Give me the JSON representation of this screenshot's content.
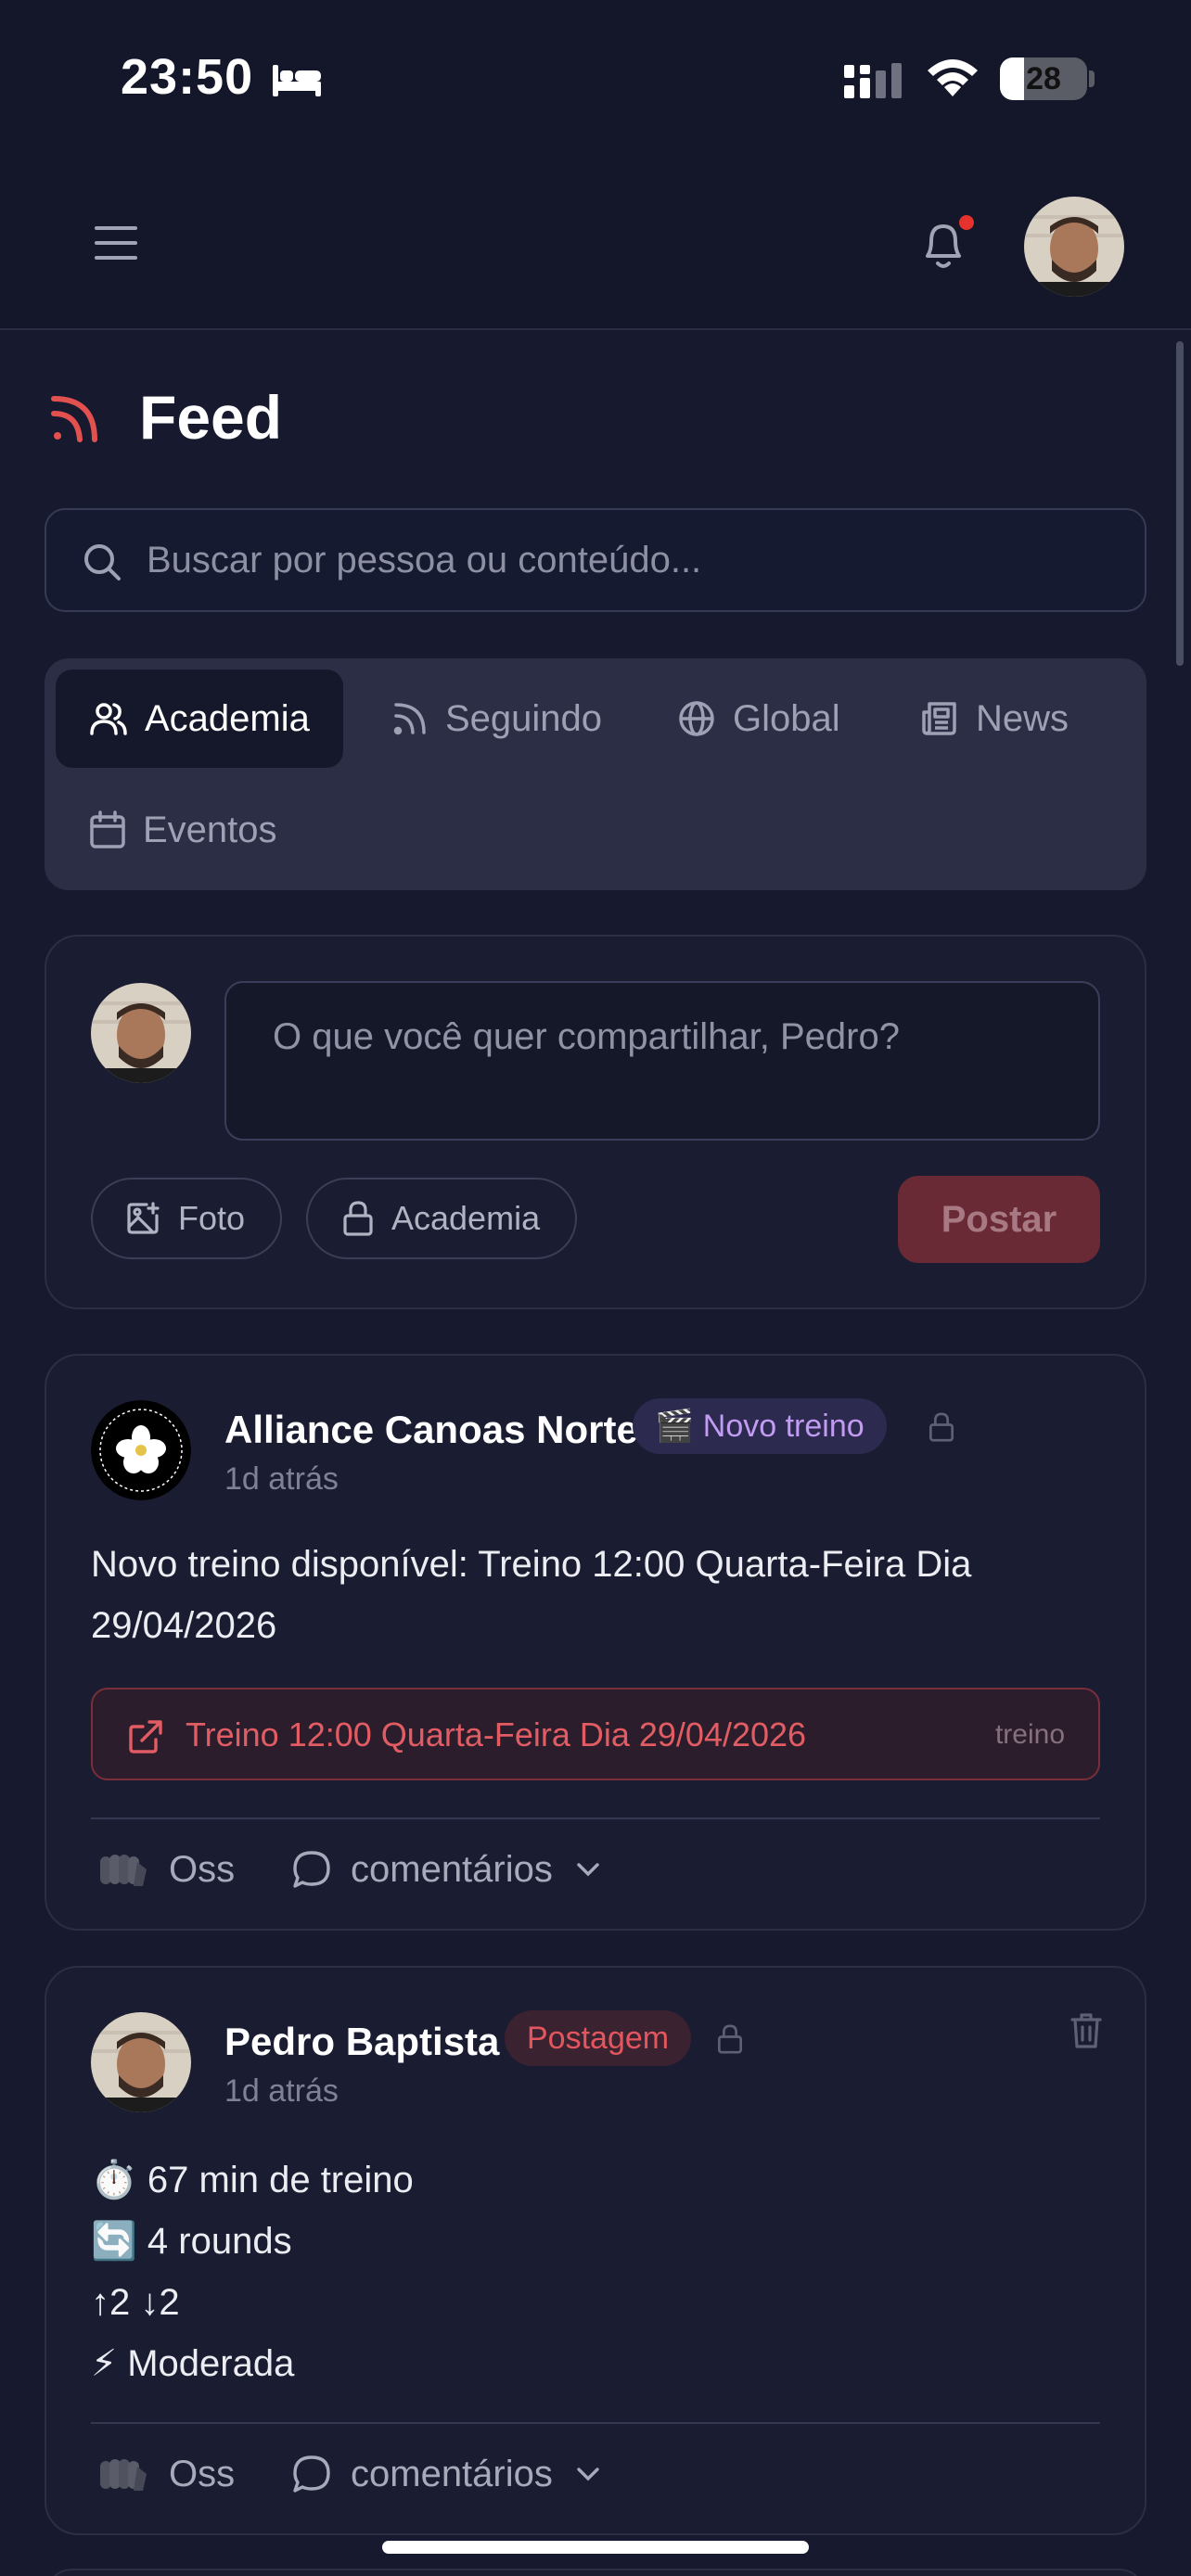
{
  "status_bar": {
    "time": "23:50",
    "battery": "28",
    "battery_fraction": 0.28
  },
  "header": {
    "notification_dot": true
  },
  "page": {
    "title": "Feed"
  },
  "search": {
    "placeholder": "Buscar por pessoa ou conteúdo..."
  },
  "tabs": [
    {
      "label": "Academia",
      "icon": "users-icon",
      "active": true
    },
    {
      "label": "Seguindo",
      "icon": "rss-icon",
      "active": false
    },
    {
      "label": "Global",
      "icon": "globe-icon",
      "active": false
    },
    {
      "label": "News",
      "icon": "newspaper-icon",
      "active": false
    },
    {
      "label": "Eventos",
      "icon": "calendar-icon",
      "active": false
    }
  ],
  "composer": {
    "placeholder": "O que você quer compartilhar, Pedro?",
    "photo_label": "Foto",
    "visibility_label": "Academia",
    "post_label": "Postar"
  },
  "posts": [
    {
      "author": "Alliance Canoas Norte",
      "badge": "🎬 Novo treino",
      "time": "1d atrás",
      "text_lines": [
        "Novo treino disponível: Treino 12:00 Quarta-Feira Dia",
        "29/04/2026"
      ],
      "link_title": "Treino 12:00 Quarta-Feira Dia 29/04/2026",
      "link_tag": "treino",
      "react_label": "Oss",
      "comments_label": "comentários"
    },
    {
      "author": "Pedro Baptista",
      "badge": "Postagem",
      "time": "1d atrás",
      "text_lines": [
        "⏱️ 67 min de treino",
        "🔄 4 rounds",
        "↑2 ↓2",
        "⚡ Moderada"
      ],
      "react_label": "Oss",
      "comments_label": "comentários"
    }
  ],
  "colors": {
    "background": "#171a2e",
    "accent_red": "#e25d63",
    "badge_purple": "#c29bf2",
    "post_button": "#6a2a35"
  }
}
